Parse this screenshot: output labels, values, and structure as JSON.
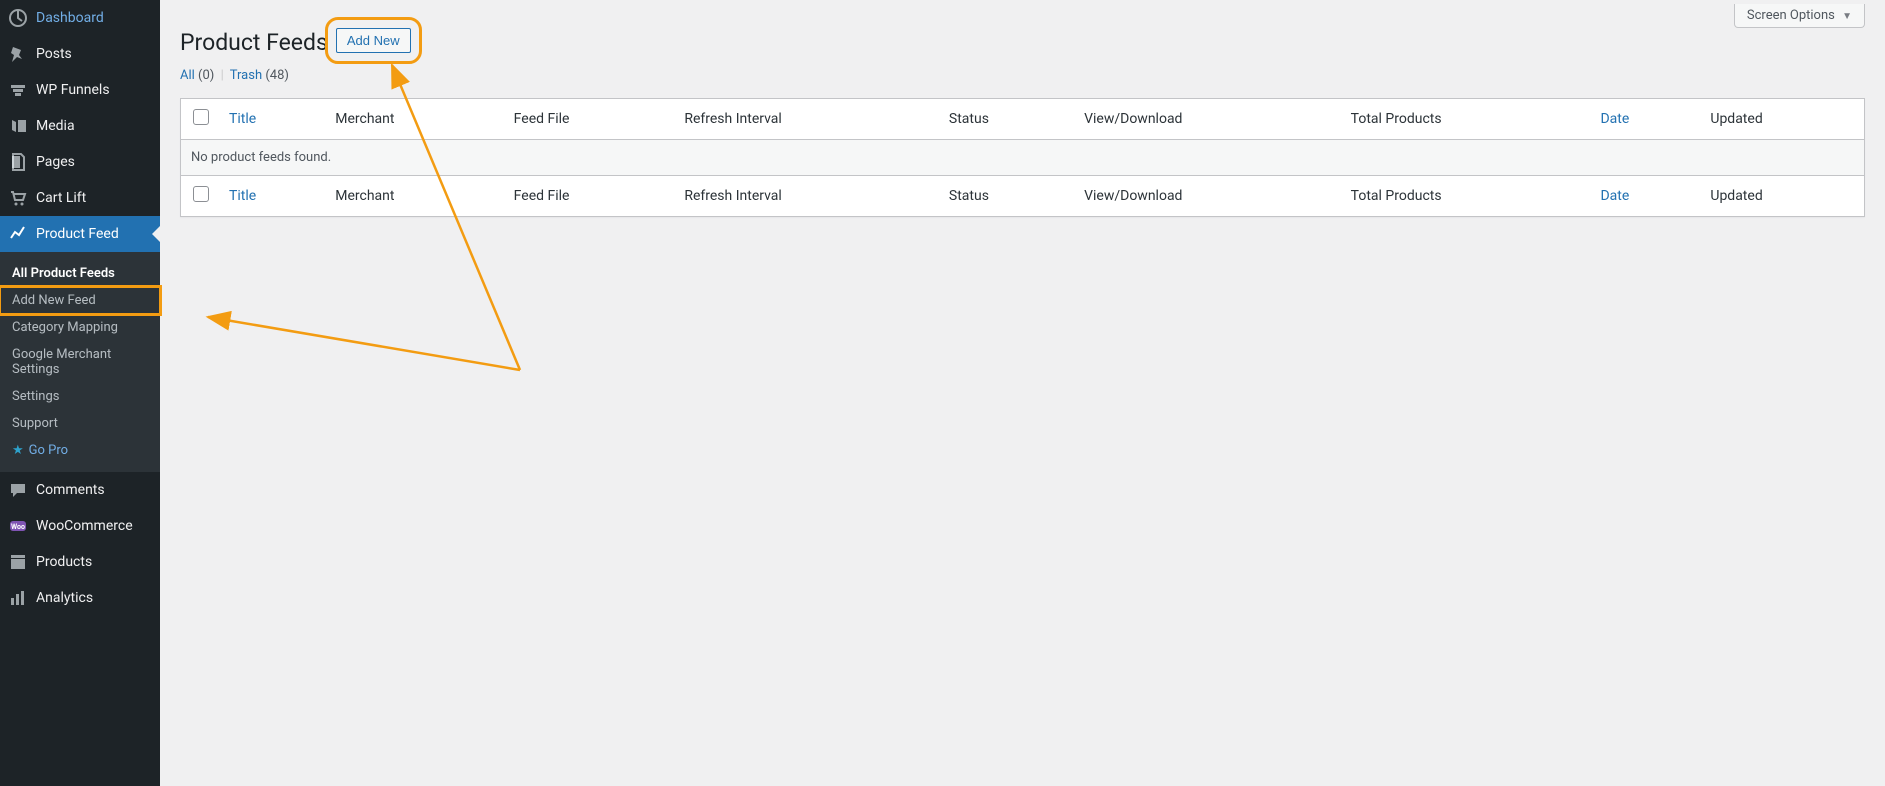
{
  "sidebar": {
    "items": [
      {
        "label": "Dashboard",
        "icon": "dashboard"
      },
      {
        "label": "Posts",
        "icon": "pin"
      },
      {
        "label": "WP Funnels",
        "icon": "funnel"
      },
      {
        "label": "Media",
        "icon": "media"
      },
      {
        "label": "Pages",
        "icon": "page"
      },
      {
        "label": "Cart Lift",
        "icon": "cart"
      },
      {
        "label": "Product Feed",
        "icon": "chart"
      }
    ],
    "submenu": [
      {
        "label": "All Product Feeds"
      },
      {
        "label": "Add New Feed"
      },
      {
        "label": "Category Mapping"
      },
      {
        "label": "Google Merchant Settings"
      },
      {
        "label": "Settings"
      },
      {
        "label": "Support"
      },
      {
        "label": "Go Pro"
      }
    ],
    "bottom": [
      {
        "label": "Comments",
        "icon": "comment"
      },
      {
        "label": "WooCommerce",
        "icon": "woo"
      },
      {
        "label": "Products",
        "icon": "products"
      },
      {
        "label": "Analytics",
        "icon": "analytics"
      }
    ]
  },
  "screen_options_label": "Screen Options",
  "page_title": "Product Feeds",
  "add_new_label": "Add New",
  "subsubsub": {
    "all_label": "All",
    "all_count": "(0)",
    "trash_label": "Trash",
    "trash_count": "(48)"
  },
  "table": {
    "columns": [
      "Title",
      "Merchant",
      "Feed File",
      "Refresh Interval",
      "Status",
      "View/Download",
      "Total Products",
      "Date",
      "Updated"
    ],
    "empty_message": "No product feeds found."
  }
}
